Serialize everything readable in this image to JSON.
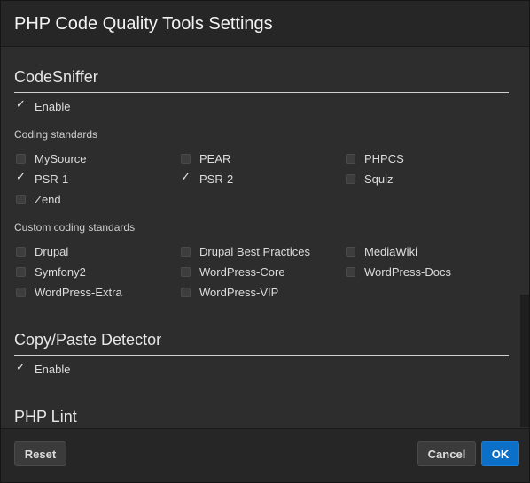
{
  "dialog": {
    "title": "PHP Code Quality Tools Settings"
  },
  "codesniffer": {
    "title": "CodeSniffer",
    "enable": {
      "label": "Enable",
      "checked": true
    },
    "coding_standards_label": "Coding standards",
    "standards": [
      {
        "label": "MySource",
        "checked": false
      },
      {
        "label": "PEAR",
        "checked": false
      },
      {
        "label": "PHPCS",
        "checked": false
      },
      {
        "label": "PSR-1",
        "checked": true
      },
      {
        "label": "PSR-2",
        "checked": true
      },
      {
        "label": "Squiz",
        "checked": false
      },
      {
        "label": "Zend",
        "checked": false
      }
    ],
    "custom_label": "Custom coding standards",
    "custom": [
      {
        "label": "Drupal",
        "checked": false
      },
      {
        "label": "Drupal Best Practices",
        "checked": false
      },
      {
        "label": "MediaWiki",
        "checked": false
      },
      {
        "label": "Symfony2",
        "checked": false
      },
      {
        "label": "WordPress-Core",
        "checked": false
      },
      {
        "label": "WordPress-Docs",
        "checked": false
      },
      {
        "label": "WordPress-Extra",
        "checked": false
      },
      {
        "label": "WordPress-VIP",
        "checked": false
      }
    ]
  },
  "cpd": {
    "title": "Copy/Paste Detector",
    "enable": {
      "label": "Enable",
      "checked": true
    }
  },
  "lint": {
    "title": "PHP Lint"
  },
  "footer": {
    "reset_label": "Reset",
    "cancel_label": "Cancel",
    "ok_label": "OK"
  },
  "colors": {
    "primary_button": "#0d70c8",
    "background": "#2d2d2d",
    "titlebar": "#262626"
  }
}
